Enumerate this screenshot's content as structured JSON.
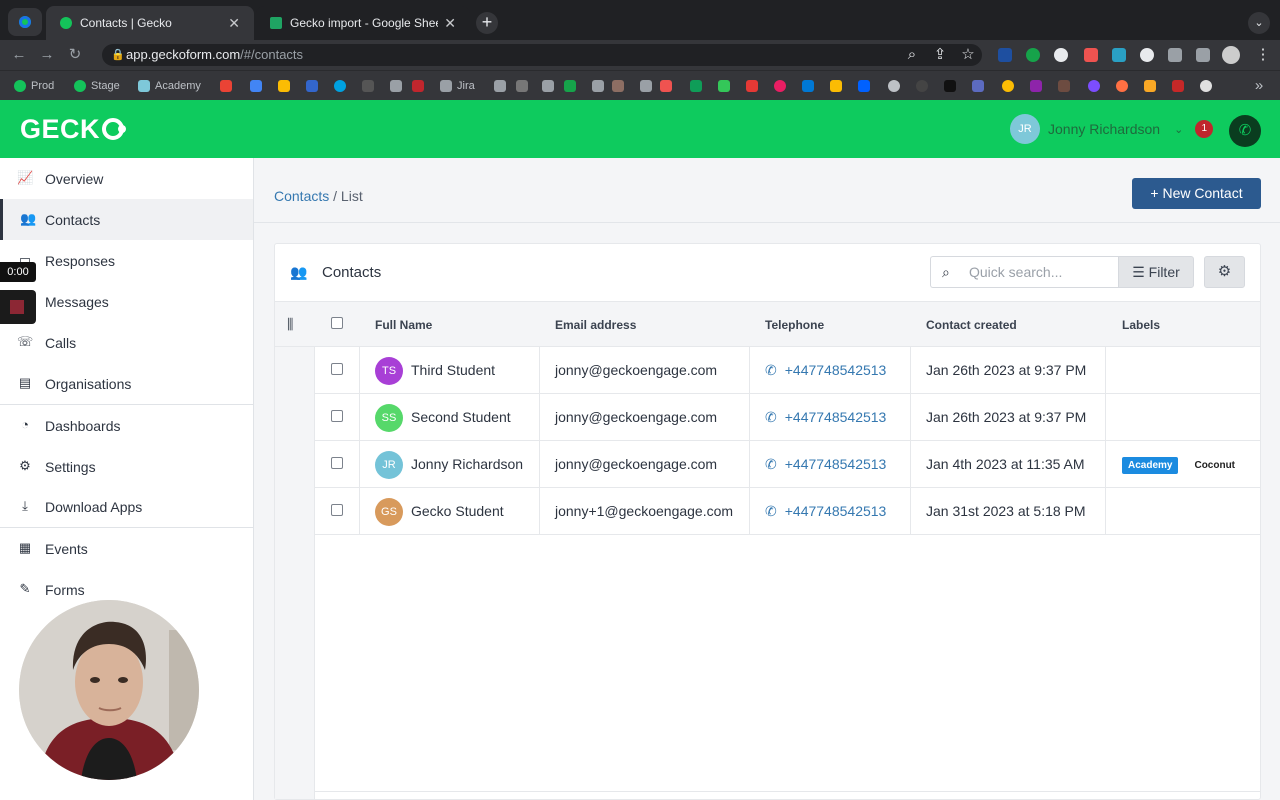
{
  "browser": {
    "tabs": [
      {
        "title": "Contacts | Gecko",
        "active": true
      },
      {
        "title": "Gecko import - Google Sheets",
        "active": false
      }
    ],
    "address": {
      "host": "app.geckoform.com",
      "path": "/#/contacts"
    },
    "bookmarks": [
      "Prod",
      "Stage",
      "Academy",
      "Jira"
    ]
  },
  "app": {
    "logo": "GECK",
    "user": {
      "initials": "JR",
      "name": "Jonny Richardson",
      "notifications": "1"
    }
  },
  "sidebar": {
    "items": [
      {
        "label": "Overview",
        "icon": "chart-icon"
      },
      {
        "label": "Contacts",
        "icon": "users-icon",
        "active": true
      },
      {
        "label": "Responses",
        "icon": "inbox-icon"
      },
      {
        "label": "Messages",
        "icon": "message-icon"
      },
      {
        "label": "Calls",
        "icon": "phone-icon"
      },
      {
        "label": "Organisations",
        "icon": "building-icon"
      },
      {
        "label": "Dashboards",
        "icon": "gauge-icon"
      },
      {
        "label": "Settings",
        "icon": "gear-icon"
      },
      {
        "label": "Download Apps",
        "icon": "download-icon"
      },
      {
        "label": "Events",
        "icon": "calendar-icon"
      },
      {
        "label": "Forms",
        "icon": "form-icon"
      }
    ],
    "recording_time": "0:00"
  },
  "breadcrumb": {
    "root": "Contacts",
    "separator": "/",
    "current": "List"
  },
  "new_contact_button": "+ New Contact",
  "panel": {
    "title": "Contacts",
    "search_placeholder": "Quick search...",
    "filter_label": "Filter"
  },
  "table": {
    "headers": [
      "Full Name",
      "Email address",
      "Telephone",
      "Contact created",
      "Labels"
    ],
    "rows": [
      {
        "initials": "TS",
        "avatar_color": "#a83fd6",
        "name": "Third Student",
        "email": "jonny@geckoengage.com",
        "phone": "+447748542513",
        "created": "Jan 26th 2023 at 9:37 PM",
        "labels": []
      },
      {
        "initials": "SS",
        "avatar_color": "#56d86a",
        "name": "Second Student",
        "email": "jonny@geckoengage.com",
        "phone": "+447748542513",
        "created": "Jan 26th 2023 at 9:37 PM",
        "labels": []
      },
      {
        "initials": "JR",
        "avatar_color": "#74c3d8",
        "name": "Jonny Richardson",
        "email": "jonny@geckoengage.com",
        "phone": "+447748542513",
        "created": "Jan 4th 2023 at 11:35 AM",
        "labels": [
          "Academy",
          "Coconut"
        ]
      },
      {
        "initials": "GS",
        "avatar_color": "#d89a5c",
        "name": "Gecko Student",
        "email": "jonny+1@geckoengage.com",
        "phone": "+447748542513",
        "created": "Jan 31st 2023 at 5:18 PM",
        "labels": []
      }
    ]
  },
  "colors": {
    "brand_green": "#0ecb5e",
    "primary_button": "#2c5a8f",
    "link": "#3578b0"
  }
}
